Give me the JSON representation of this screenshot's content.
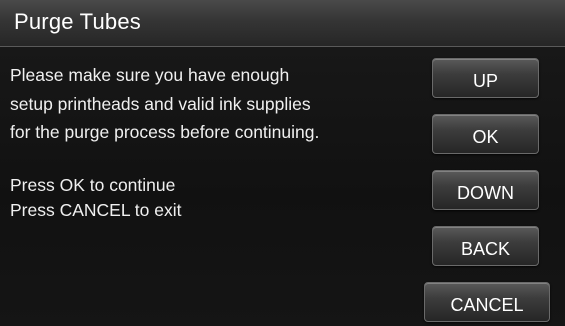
{
  "header": {
    "title": "Purge Tubes"
  },
  "message": {
    "lines": [
      "Please make sure you have enough",
      "setup printheads and valid ink supplies",
      "for the purge process before continuing."
    ],
    "instructions": [
      "Press OK to continue",
      "Press CANCEL to exit"
    ]
  },
  "buttons": {
    "up": "UP",
    "ok": "OK",
    "down": "DOWN",
    "back": "BACK",
    "cancel": "CANCEL"
  },
  "colors": {
    "background": "#111111",
    "title_bar": "#353535",
    "text": "#f0f0f0",
    "button": "#3c3c3c"
  }
}
